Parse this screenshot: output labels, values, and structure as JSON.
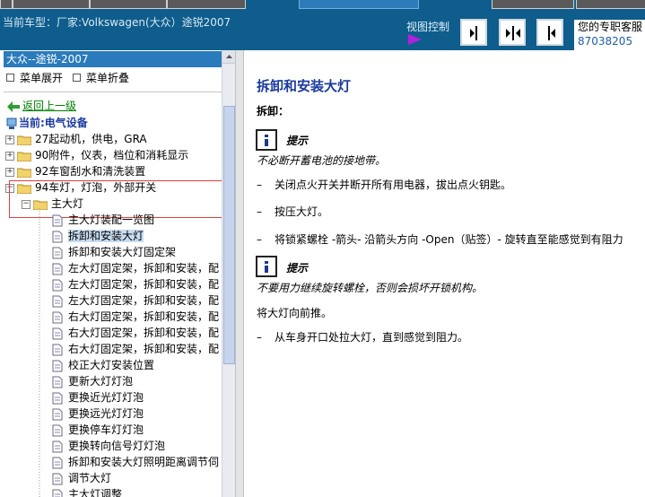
{
  "header": {
    "vehicle": "当前车型：厂家:Volkswagen(大众）途锐2007",
    "view_control_label": "视图控制",
    "service_label": "您的专职客服",
    "service_number": "87038205"
  },
  "tree": {
    "header": "大众--途锐-2007",
    "menu_expand": "菜单展开",
    "menu_collapse": "菜单折叠",
    "back": "返回上一级",
    "current": "当前:电气设备",
    "groups": [
      {
        "label": "27起动机，供电，GRA"
      },
      {
        "label": "90附件，仪表，档位和消耗显示"
      },
      {
        "label": "92车窗刮水和清洗装置"
      },
      {
        "label": "94车灯，灯泡，外部开关"
      }
    ],
    "subfolder": "主大灯",
    "items": [
      "主大灯装配一览图",
      "拆卸和安装大灯",
      "拆卸和安装大灯固定架",
      "左大灯固定架，拆卸和安装，配",
      "左大灯固定架，拆卸和安装，配",
      "左大灯固定架，拆卸和安装，配",
      "右大灯固定架，拆卸和安装，配",
      "右大灯固定架，拆卸和安装，配",
      "右大灯固定架，拆卸和安装，配",
      "校正大灯安装位置",
      "更新大灯灯泡",
      "更换近光灯灯泡",
      "更换远光灯灯泡",
      "更换停车灯灯泡",
      "更换转向信号灯灯泡",
      "拆卸和安装大灯照明距离调节伺",
      "调节大灯",
      "主大灯调整"
    ]
  },
  "content": {
    "title": "拆卸和安装大灯",
    "removal_heading": "拆卸：",
    "note_label": "提示",
    "note1": "不必断开蓄电池的接地带。",
    "step1": "关闭点火开关并断开所有用电器，拔出点火钥匙。",
    "step2": "按压大灯。",
    "step3": "将锁紧螺栓  -箭头- 沿箭头方向  -Open（贴签）- 旋转直至能感觉到有阻力",
    "note2": "不要用力继续旋转螺栓，否则会损坏开锁机构。",
    "push_text": "将大灯向前推。",
    "step4": "从车身开口处拉大灯，直到感觉到阻力。"
  },
  "colors": {
    "topbar": "#0e5d8c",
    "tree_header": "#2a7bbc",
    "title": "#1a3aa0",
    "back_link": "#008000",
    "highlight_border": "#e04040"
  }
}
